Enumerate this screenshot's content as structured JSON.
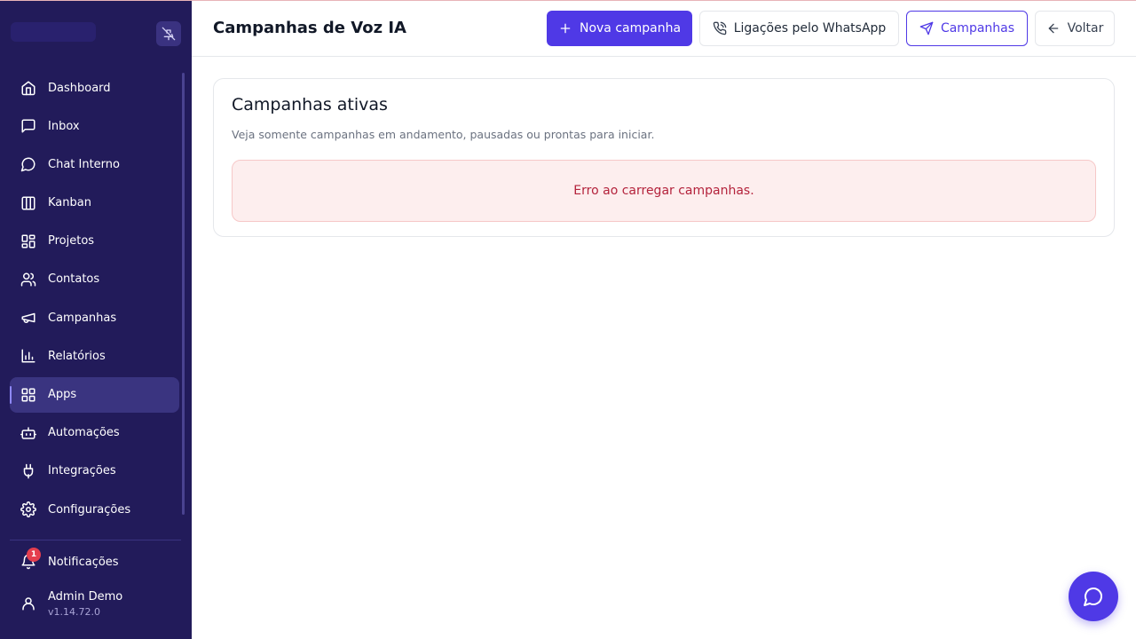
{
  "header": {
    "title": "Campanhas de Voz IA",
    "new_campaign_label": "Nova campanha",
    "whatsapp_calls_label": "Ligações pelo WhatsApp",
    "campaigns_label": "Campanhas",
    "back_label": "Voltar"
  },
  "sidebar": {
    "items": [
      {
        "label": "Dashboard",
        "icon": "home-icon"
      },
      {
        "label": "Inbox",
        "icon": "message-square-icon"
      },
      {
        "label": "Chat Interno",
        "icon": "message-circle-icon"
      },
      {
        "label": "Kanban",
        "icon": "kanban-icon"
      },
      {
        "label": "Projetos",
        "icon": "grid-icon"
      },
      {
        "label": "Contatos",
        "icon": "users-icon"
      },
      {
        "label": "Campanhas",
        "icon": "megaphone-icon"
      },
      {
        "label": "Relatórios",
        "icon": "bar-chart-icon"
      },
      {
        "label": "Apps",
        "icon": "apps-icon",
        "active": true
      },
      {
        "label": "Automações",
        "icon": "bot-icon"
      },
      {
        "label": "Integrações",
        "icon": "plug-icon"
      },
      {
        "label": "Configurações",
        "icon": "gear-icon"
      }
    ],
    "notifications": {
      "label": "Notificações",
      "count": "1"
    },
    "user": {
      "name": "Admin Demo",
      "version": "v1.14.72.0"
    }
  },
  "card": {
    "title": "Campanhas ativas",
    "subtitle": "Veja somente campanhas em andamento, pausadas ou prontas para iniciar.",
    "error": "Erro ao carregar campanhas."
  },
  "colors": {
    "sidebar_bg": "#221b5a",
    "accent": "#4f39e6",
    "error_text": "#b4233c",
    "error_bg": "#fdeeee"
  }
}
